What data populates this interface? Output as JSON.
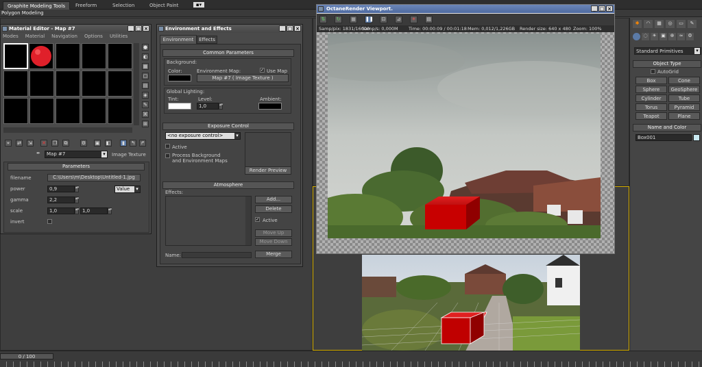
{
  "topbar": {
    "tabs": [
      "Graphite Modeling Tools",
      "Freeform",
      "Selection",
      "Object Paint"
    ],
    "subtitle": "Polygon Modeling"
  },
  "material_editor": {
    "title": "Material Editor - Map #7",
    "menu": [
      "Modes",
      "Material",
      "Navigation",
      "Options",
      "Utilities"
    ],
    "map_name": "Map #7",
    "map_type": "Image Texture",
    "parameters_label": "Parameters",
    "params": [
      {
        "label": "filename",
        "value": "C:\\Users\\m\\Desktop\\Untitled-1.jpg"
      },
      {
        "label": "power",
        "value": "0,9"
      },
      {
        "label": "gamma",
        "value": "2,2"
      },
      {
        "label": "scale",
        "value": "1,0",
        "value2": "1,0"
      },
      {
        "label": "invert",
        "value": ""
      }
    ],
    "power_mode": "Value"
  },
  "env_effects": {
    "title": "Environment and Effects",
    "tabs": [
      "Environment",
      "Effects"
    ],
    "common_params": "Common Parameters",
    "background_label": "Background:",
    "color_label": "Color:",
    "env_map_label": "Environment Map:",
    "use_map_label": "Use Map",
    "map_button": "Map #7  ( Image Texture )",
    "global_lighting": "Global Lighting:",
    "tint_label": "Tint:",
    "level_label": "Level:",
    "level_value": "1,0",
    "ambient_label": "Ambient:",
    "exposure_control": "Exposure Control",
    "exposure_select": "<no exposure control>",
    "active_label": "Active",
    "process_bg_line1": "Process Background",
    "process_bg_line2": "and Environment Maps",
    "render_preview": "Render Preview",
    "atmosphere": "Atmosphere",
    "effects_label": "Effects:",
    "add": "Add...",
    "delete": "Delete",
    "atm_active": "Active",
    "move_up": "Move Up",
    "move_down": "Move Down",
    "name_label": "Name:",
    "merge": "Merge"
  },
  "octane": {
    "title": "OctaneRender Viewport.",
    "status": [
      "Samp/pix: 1831/16000",
      "Samp/s: 0,000M",
      "Time: 00:00:09 / 00:01:18",
      "Mem: 0,012/1,226GB",
      "Render size: 640 x 480",
      "Zoom: 100%"
    ]
  },
  "command_panel": {
    "dropdown": "Standard Primitives",
    "object_type": "Object Type",
    "autogrid": "AutoGrid",
    "buttons": [
      "Box",
      "Cone",
      "Sphere",
      "GeoSphere",
      "Cylinder",
      "Tube",
      "Torus",
      "Pyramid",
      "Teapot",
      "Plane"
    ],
    "name_color": "Name and Color",
    "object_name": "Box001"
  },
  "timeline": {
    "frame": "0 / 100"
  },
  "colors": {
    "object_color": "#c8e8f0",
    "box_red": "#c00000"
  }
}
